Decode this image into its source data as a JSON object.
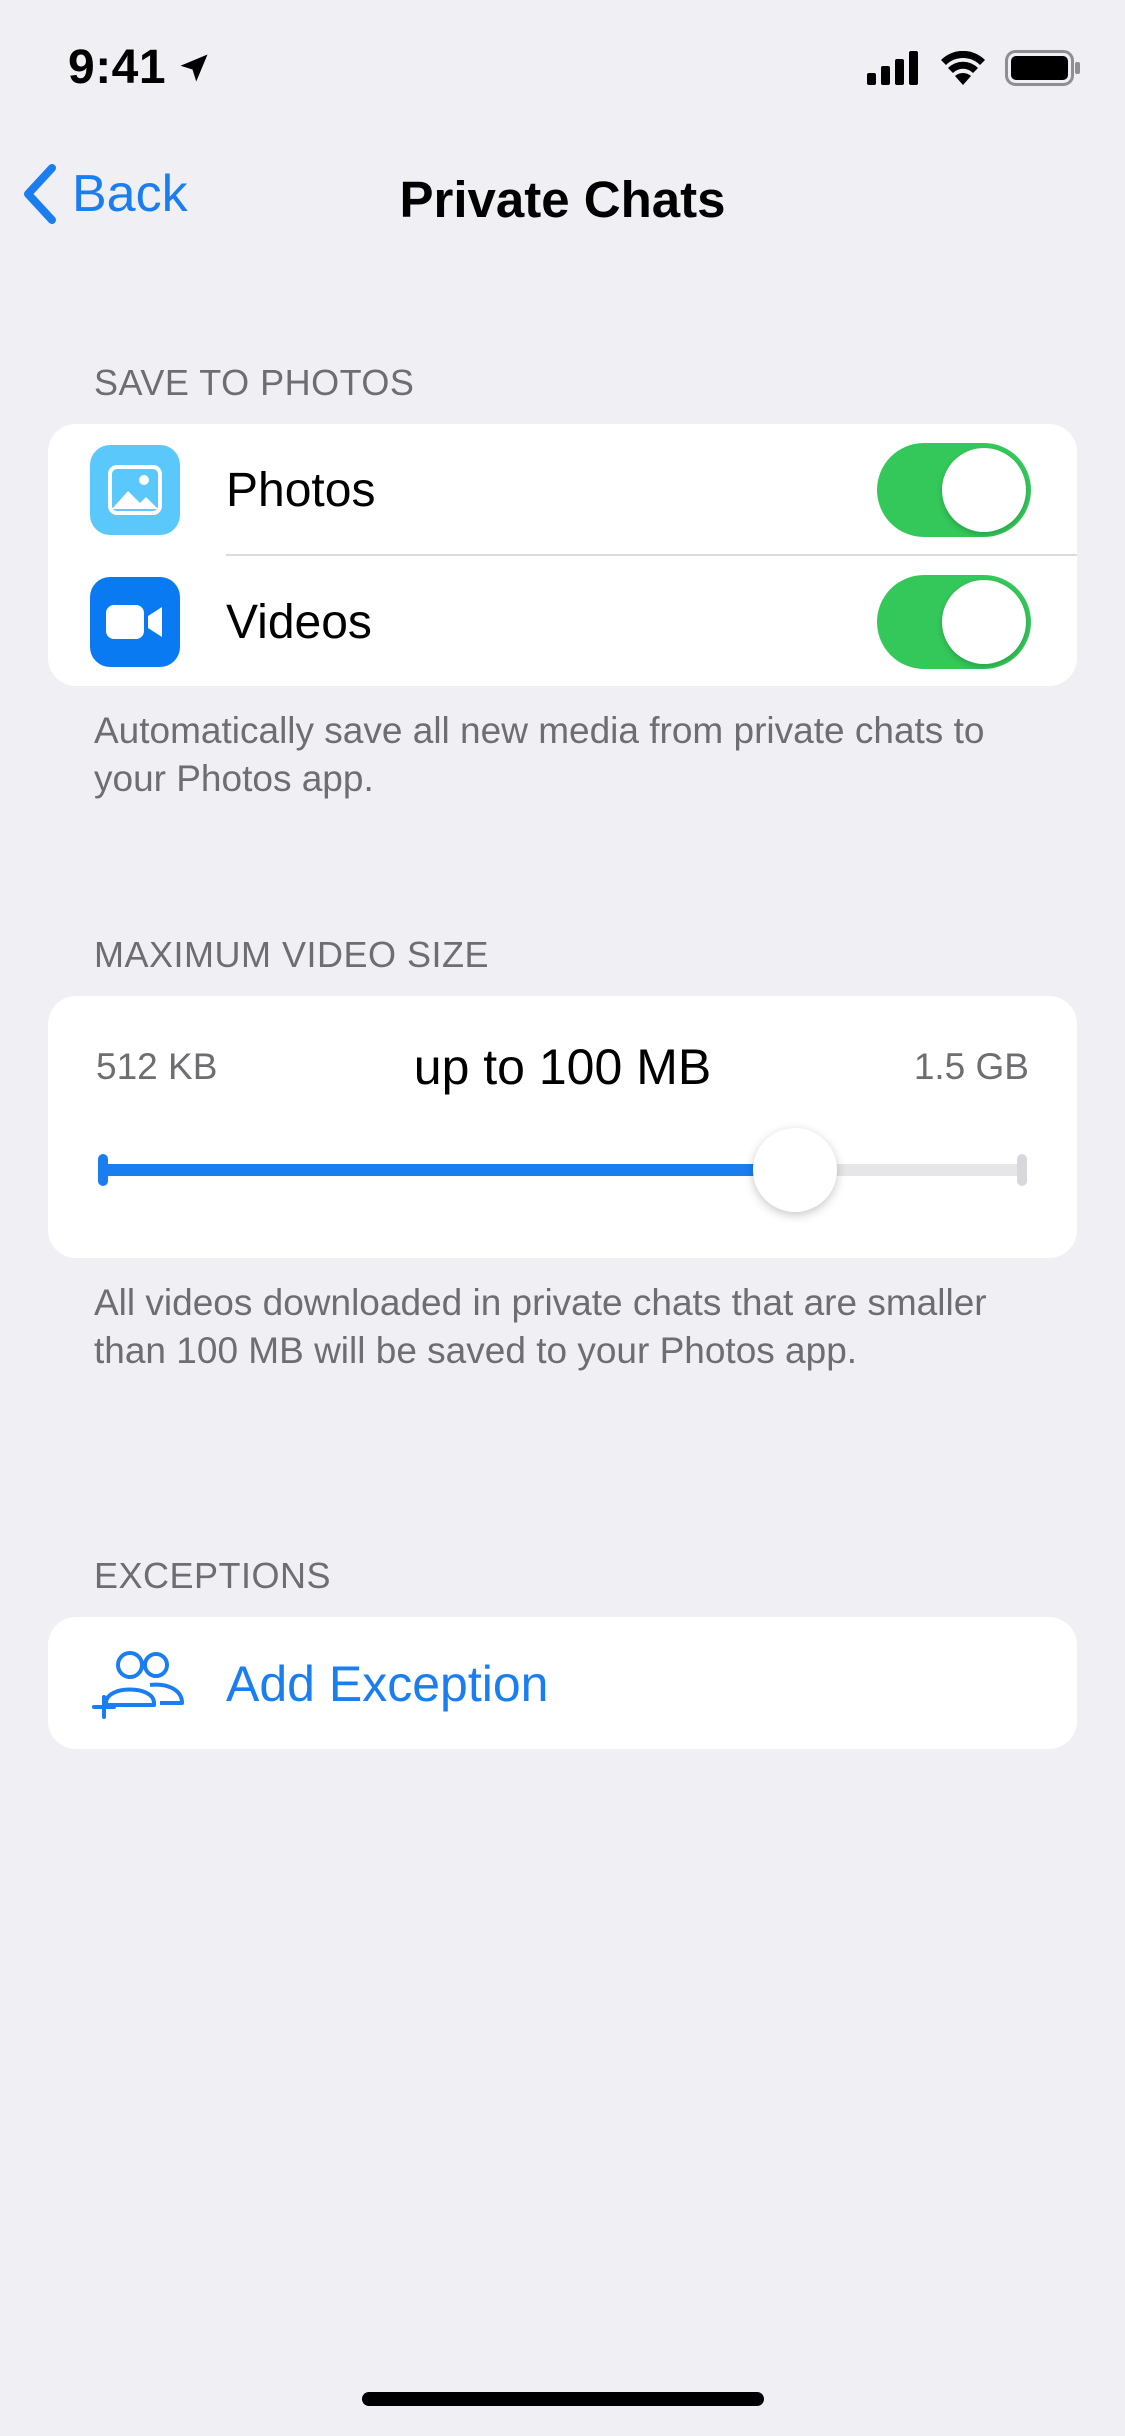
{
  "status_bar": {
    "time": "9:41"
  },
  "nav": {
    "back_label": "Back",
    "title": "Private Chats"
  },
  "save_to_photos": {
    "header": "SAVE TO PHOTOS",
    "rows": [
      {
        "label": "Photos",
        "icon": "photo-icon",
        "enabled": true
      },
      {
        "label": "Videos",
        "icon": "video-icon",
        "enabled": true
      }
    ],
    "footer": "Automatically save all new media from private chats to your Photos app."
  },
  "max_video_size": {
    "header": "MAXIMUM VIDEO SIZE",
    "min_label": "512 KB",
    "max_label": "1.5 GB",
    "current_label": "up to 100 MB",
    "slider_fraction": 0.75,
    "footer": "All videos downloaded in private chats that are smaller than 100 MB will be saved to your Photos app."
  },
  "exceptions": {
    "header": "EXCEPTIONS",
    "add_label": "Add Exception",
    "icon": "add-users-icon"
  },
  "colors": {
    "accent": "#1a7ef0",
    "toggle_on": "#34c759",
    "background": "#efeff4",
    "photos_icon_bg": "#5ac8fa",
    "videos_icon_bg": "#0a7af2"
  }
}
